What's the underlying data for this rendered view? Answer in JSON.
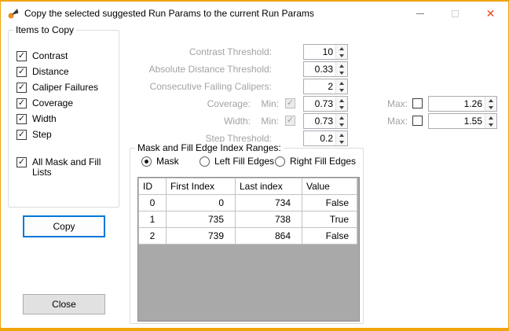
{
  "colors": {
    "accent": "#0078d7",
    "window_border": "#f0a30a",
    "close_glyph_color": "#e8431a",
    "disabled_text": "#a3a3a3",
    "grid_background": "#a9a9a9"
  },
  "window": {
    "title": "Copy the selected suggested Run Params to the current Run Params",
    "close_glyph": "✕"
  },
  "items_to_copy": {
    "legend": "Items to Copy",
    "items": [
      {
        "label": "Contrast",
        "checked": true
      },
      {
        "label": "Distance",
        "checked": true
      },
      {
        "label": "Caliper Failures",
        "checked": true
      },
      {
        "label": "Coverage",
        "checked": true
      },
      {
        "label": "Width",
        "checked": true
      },
      {
        "label": "Step",
        "checked": true
      },
      {
        "label": "All Mask and Fill Lists",
        "checked": true,
        "gap_before": true
      }
    ]
  },
  "buttons": {
    "copy": "Copy",
    "close": "Close"
  },
  "params": {
    "rows": [
      {
        "label": "Contrast Threshold:",
        "value": "10"
      },
      {
        "label": "Absolute Distance Threshold:",
        "value": "0.33"
      },
      {
        "label": "Consecutive Failing Calipers:",
        "value": "2"
      },
      {
        "label": "Coverage:",
        "min": {
          "label": "Min:",
          "checked": true,
          "value": "0.73"
        },
        "max": {
          "label": "Max:",
          "checked": false,
          "value": "1.26"
        }
      },
      {
        "label": "Width:",
        "min": {
          "label": "Min:",
          "checked": true,
          "value": "0.73"
        },
        "max": {
          "label": "Max:",
          "checked": false,
          "value": "1.55"
        }
      },
      {
        "label": "Step Threshold:",
        "value": "0.2"
      }
    ]
  },
  "mask_group": {
    "legend": "Mask and Fill Edge Index Ranges:",
    "radios": [
      {
        "label": "Mask",
        "selected": true
      },
      {
        "label": "Left Fill Edges",
        "selected": false
      },
      {
        "label": "Right Fill Edges",
        "selected": false
      }
    ],
    "grid": {
      "columns": [
        "ID",
        "First Index",
        "Last index",
        "Value"
      ],
      "rows": [
        [
          "0",
          "0",
          "734",
          "False"
        ],
        [
          "1",
          "735",
          "738",
          "True"
        ],
        [
          "2",
          "739",
          "864",
          "False"
        ]
      ]
    }
  }
}
